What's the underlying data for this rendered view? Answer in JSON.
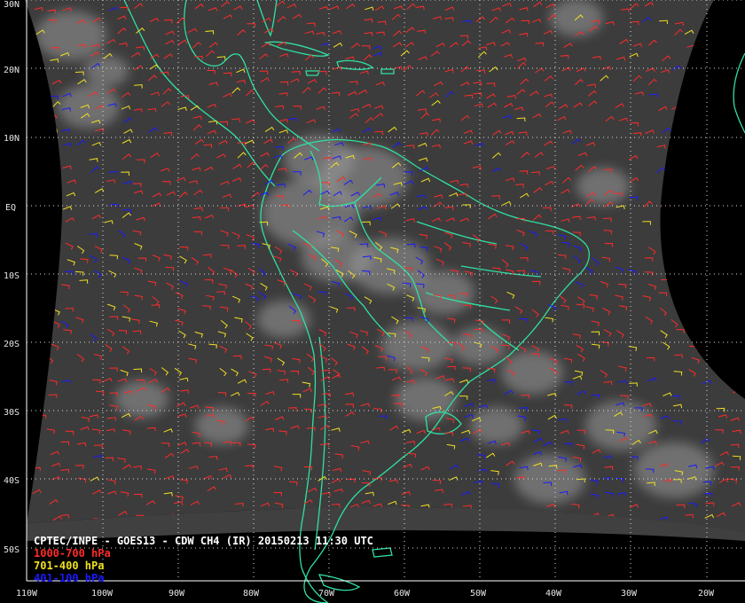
{
  "title": "CPTEC/INPE - GOES13 - CDW CH4 (IR) 20150213 11:30 UTC",
  "colors": {
    "low_winds": "#ff2a2a",
    "mid_winds": "#f0e020",
    "high_winds": "#1a1aff",
    "coastline": "#30e0a0",
    "grid": "#dddddd",
    "background": "#000000",
    "cloud_base": "#3c3c3c"
  },
  "legend": [
    {
      "label": "1000-700 hPa",
      "color": "#ff2a2a"
    },
    {
      "label": "701-400 hPa",
      "color": "#f0e020"
    },
    {
      "label": "401-100 hPa",
      "color": "#1a1aff"
    }
  ],
  "latitude_labels": [
    "30N",
    "20N",
    "10N",
    "EQ",
    "10S",
    "20S",
    "30S",
    "40S",
    "50S"
  ],
  "longitude_labels": [
    "110W",
    "100W",
    "90W",
    "80W",
    "70W",
    "60W",
    "50W",
    "40W",
    "30W",
    "20W"
  ],
  "icons": {
    "wind_barb": "wind-barb-icon",
    "grid": "lat-lon-grid"
  }
}
